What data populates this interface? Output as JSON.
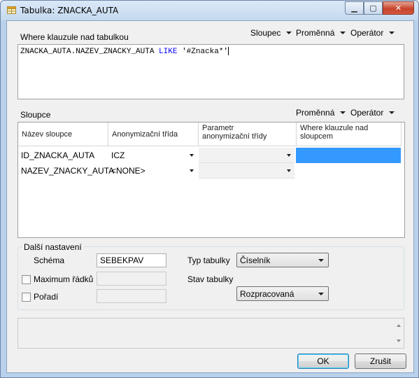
{
  "window": {
    "title": "Tabulka: ZNACKA_AUTA",
    "controls": [
      "minimize",
      "maximize",
      "close"
    ]
  },
  "where_section": {
    "label": "Where klauzule nad tabulkou",
    "menus": [
      "Sloupec",
      "Proměnná",
      "Operátor"
    ],
    "clause": {
      "field": "ZNACKA_AUTA.NAZEV_ZNACKY_AUTA",
      "keyword": "LIKE",
      "value": "'#Znacka*'"
    }
  },
  "columns_section": {
    "label": "Sloupce",
    "menus": [
      "Proměnná",
      "Operátor"
    ],
    "headers": {
      "column_name": "Název sloupce",
      "anon_class": "Anonymizační třída",
      "anon_param_1": "Parametr",
      "anon_param_2": "anonymizační třídy",
      "where_col_1": "Where klauzule nad",
      "where_col_2": "sloupcem"
    },
    "rows": [
      {
        "name": "ID_ZNACKA_AUTA",
        "anon_class": "ICZ",
        "param": "",
        "where": ""
      },
      {
        "name": "NAZEV_ZNACKY_AUTA",
        "anon_class": "<NONE>",
        "param": "",
        "where": ""
      }
    ]
  },
  "settings": {
    "label": "Další nastavení",
    "schema_label": "Schéma",
    "schema_value": "SEBEKPAV",
    "max_rows_label": "Maximum řádků",
    "max_rows_checked": false,
    "order_label": "Pořadí",
    "order_checked": false,
    "table_type_label": "Typ tabulky",
    "table_type_value": "Číselník",
    "table_state_label": "Stav tabulky",
    "table_state_value": "Rozpracovaná"
  },
  "buttons": {
    "ok": "OK",
    "cancel": "Zrušit"
  },
  "colors": {
    "selection": "#3399ff",
    "keyword": "#0000ff",
    "window_frame": "#b9d1ea"
  }
}
